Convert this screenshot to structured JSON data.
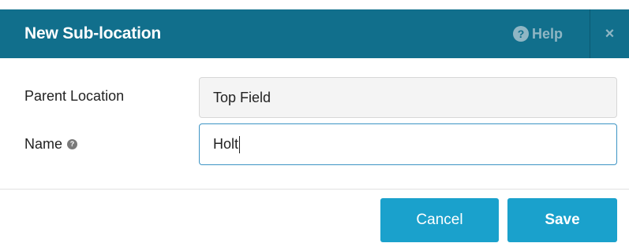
{
  "dialog": {
    "title": "New Sub-location",
    "help_label": "Help",
    "help_icon": "?",
    "close_icon": "×"
  },
  "form": {
    "parent_location": {
      "label": "Parent Location",
      "value": "Top Field"
    },
    "name": {
      "label": "Name",
      "info_icon": "?",
      "value": "Holt"
    }
  },
  "buttons": {
    "cancel_label": "Cancel",
    "save_label": "Save"
  },
  "colors": {
    "header_bg": "#116f8c",
    "button_bg": "#1aa1cc",
    "focus_border": "#3d94c4"
  }
}
